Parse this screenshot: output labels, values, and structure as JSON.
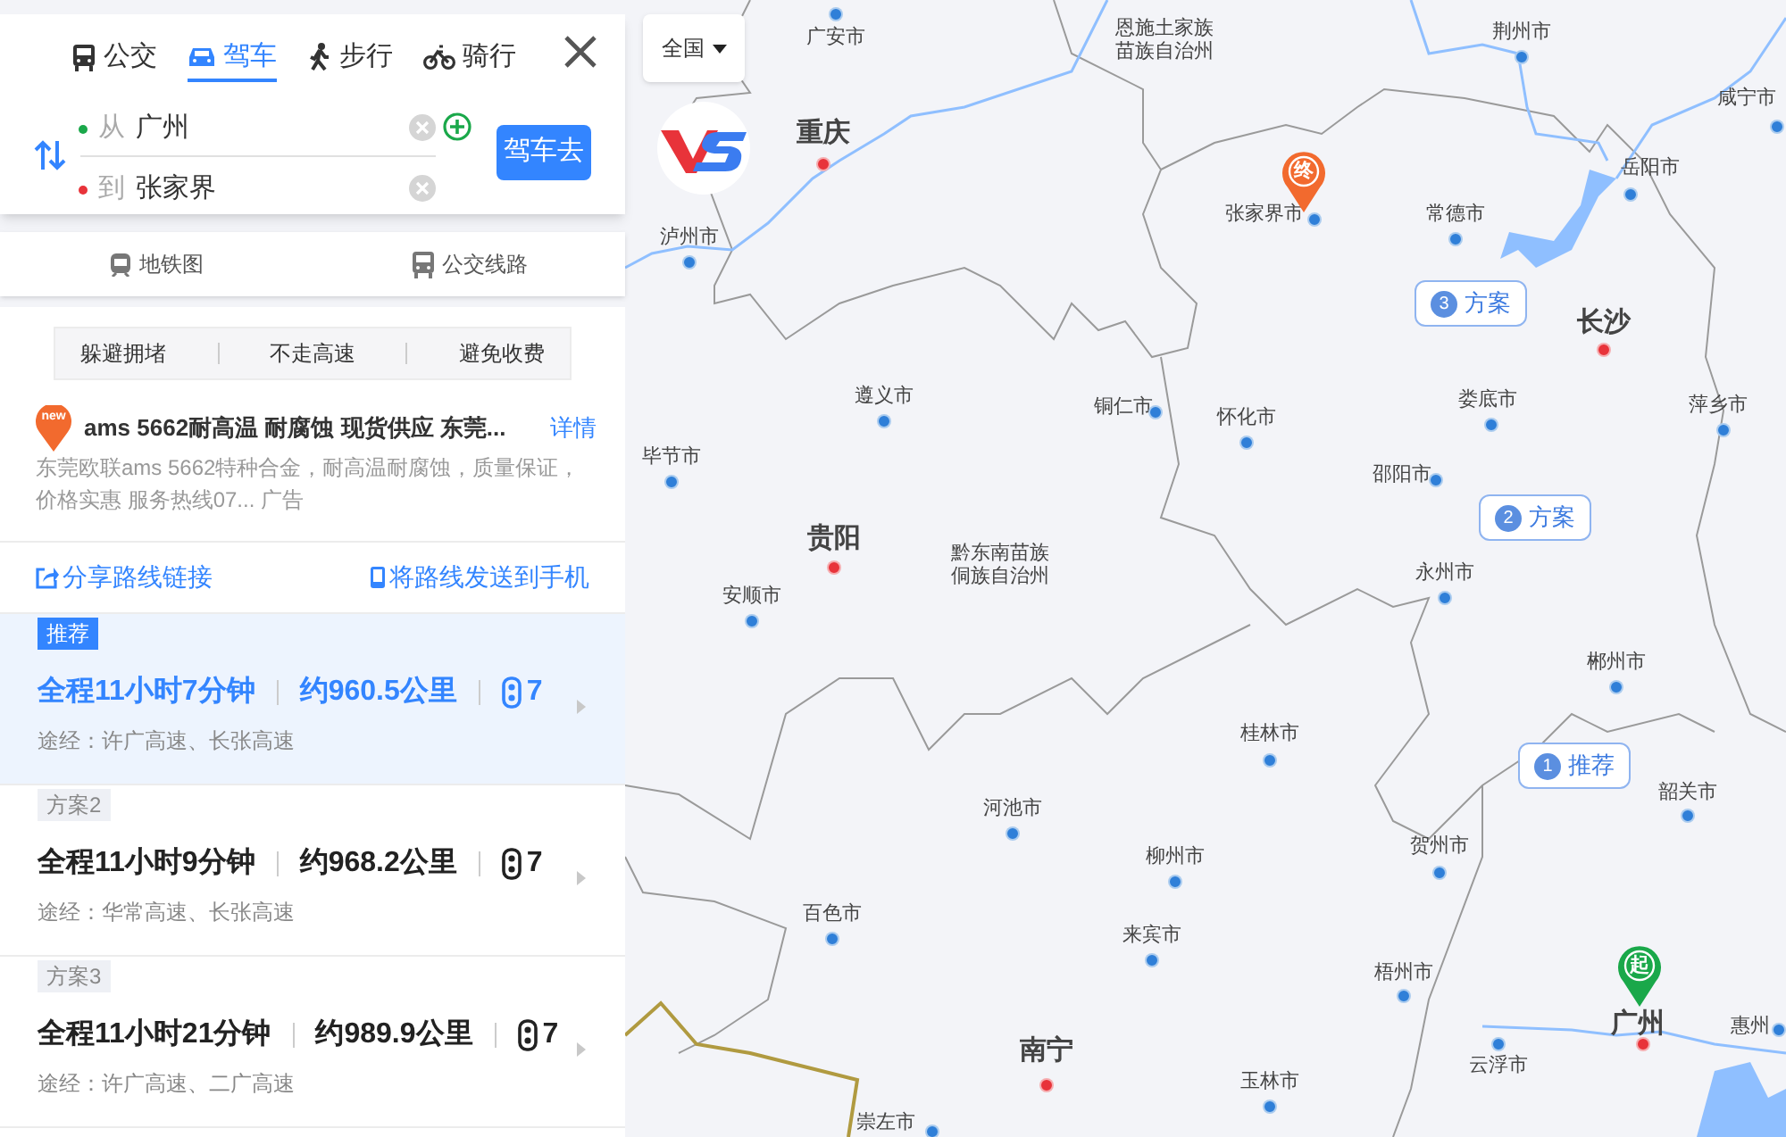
{
  "mode_tabs": [
    {
      "label": "公交",
      "selected": false
    },
    {
      "label": "驾车",
      "selected": true
    },
    {
      "label": "步行",
      "selected": false
    },
    {
      "label": "骑行",
      "selected": false
    }
  ],
  "route_form": {
    "from": {
      "prefix": "从",
      "value": "广州"
    },
    "to": {
      "prefix": "到",
      "value": "张家界"
    },
    "submit": "驾车去"
  },
  "quick_links": [
    {
      "label": "地铁图"
    },
    {
      "label": "公交线路"
    }
  ],
  "preferences": [
    "躲避拥堵",
    "不走高速",
    "避免收费"
  ],
  "ad": {
    "badge": "new",
    "title": "ams 5662耐高温 耐腐蚀 现货供应 东莞...",
    "link": "详情",
    "description": "东莞欧联ams 5662特种合金，耐高温耐腐蚀，质量保证，价格实惠 服务热线07...",
    "tag": "广告"
  },
  "share_links": [
    {
      "label": "分享路线链接"
    },
    {
      "label": "将路线发送到手机"
    }
  ],
  "routes": [
    {
      "tag": "推荐",
      "time": "全程11小时7分钟",
      "distance": "约960.5公里",
      "lights": "7",
      "via": "途经：许广高速、长张高速",
      "selected": true
    },
    {
      "tag": "方案2",
      "time": "全程11小时9分钟",
      "distance": "约968.2公里",
      "lights": "7",
      "via": "途经：华常高速、长张高速",
      "selected": false
    },
    {
      "tag": "方案3",
      "time": "全程11小时21分钟",
      "distance": "约989.9公里",
      "lights": "7",
      "via": "途经：许广高速、二广高速",
      "selected": false
    }
  ],
  "map": {
    "region_select": "全国",
    "places": [
      {
        "name": "广安市",
        "kind": "city"
      },
      {
        "name": "重庆",
        "kind": "capital"
      },
      {
        "name": "泸州市",
        "kind": "city"
      },
      {
        "name": "恩施土家族苗族自治州",
        "kind": "region"
      },
      {
        "name": "荆州市",
        "kind": "city"
      },
      {
        "name": "岳阳市",
        "kind": "city"
      },
      {
        "name": "咸宁市",
        "kind": "city"
      },
      {
        "name": "张家界市",
        "kind": "city"
      },
      {
        "name": "常德市",
        "kind": "city"
      },
      {
        "name": "长沙",
        "kind": "capital"
      },
      {
        "name": "遵义市",
        "kind": "city"
      },
      {
        "name": "铜仁市",
        "kind": "city"
      },
      {
        "name": "怀化市",
        "kind": "city"
      },
      {
        "name": "娄底市",
        "kind": "city"
      },
      {
        "name": "萍乡市",
        "kind": "city"
      },
      {
        "name": "毕节市",
        "kind": "city"
      },
      {
        "name": "邵阳市",
        "kind": "city"
      },
      {
        "name": "贵阳",
        "kind": "capital"
      },
      {
        "name": "黔东南苗族侗族自治州",
        "kind": "region"
      },
      {
        "name": "安顺市",
        "kind": "city"
      },
      {
        "name": "永州市",
        "kind": "city"
      },
      {
        "name": "郴州市",
        "kind": "city"
      },
      {
        "name": "桂林市",
        "kind": "city"
      },
      {
        "name": "韶关市",
        "kind": "city"
      },
      {
        "name": "河池市",
        "kind": "city"
      },
      {
        "name": "柳州市",
        "kind": "city"
      },
      {
        "name": "贺州市",
        "kind": "city"
      },
      {
        "name": "百色市",
        "kind": "city"
      },
      {
        "name": "来宾市",
        "kind": "city"
      },
      {
        "name": "梧州市",
        "kind": "city"
      },
      {
        "name": "广州",
        "kind": "capital"
      },
      {
        "name": "惠州",
        "kind": "city"
      },
      {
        "name": "云浮市",
        "kind": "city"
      },
      {
        "name": "南宁",
        "kind": "capital"
      },
      {
        "name": "玉林市",
        "kind": "city"
      },
      {
        "name": "崇左市",
        "kind": "city"
      }
    ],
    "route_bubbles": [
      {
        "number": "3",
        "label": "方案"
      },
      {
        "number": "2",
        "label": "方案"
      },
      {
        "number": "1",
        "label": "推荐"
      }
    ],
    "markers": [
      {
        "kind": "end",
        "label": "终"
      },
      {
        "kind": "start",
        "label": "起"
      }
    ]
  }
}
